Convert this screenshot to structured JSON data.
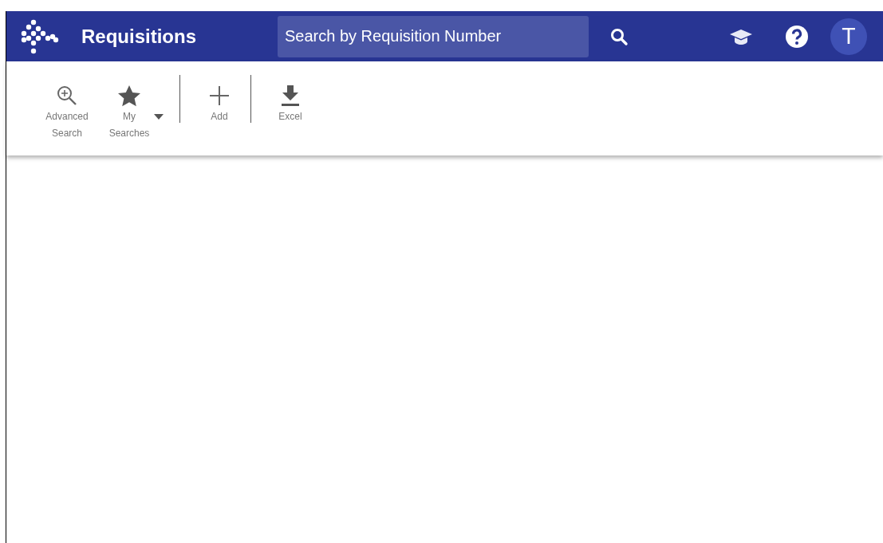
{
  "header": {
    "title": "Requisitions",
    "search": {
      "placeholder": "Search by Requisition Number"
    },
    "avatar": "T"
  },
  "toolbar": [
    {
      "kind": "button",
      "label": "Advanced Search",
      "dropdown": false
    },
    {
      "kind": "button",
      "label": "My Searches",
      "dropdown": true
    },
    {
      "kind": "divider"
    },
    {
      "kind": "button",
      "label": "Add",
      "dropdown": false
    },
    {
      "kind": "divider"
    },
    {
      "kind": "button",
      "label": "Excel",
      "dropdown": false
    }
  ]
}
